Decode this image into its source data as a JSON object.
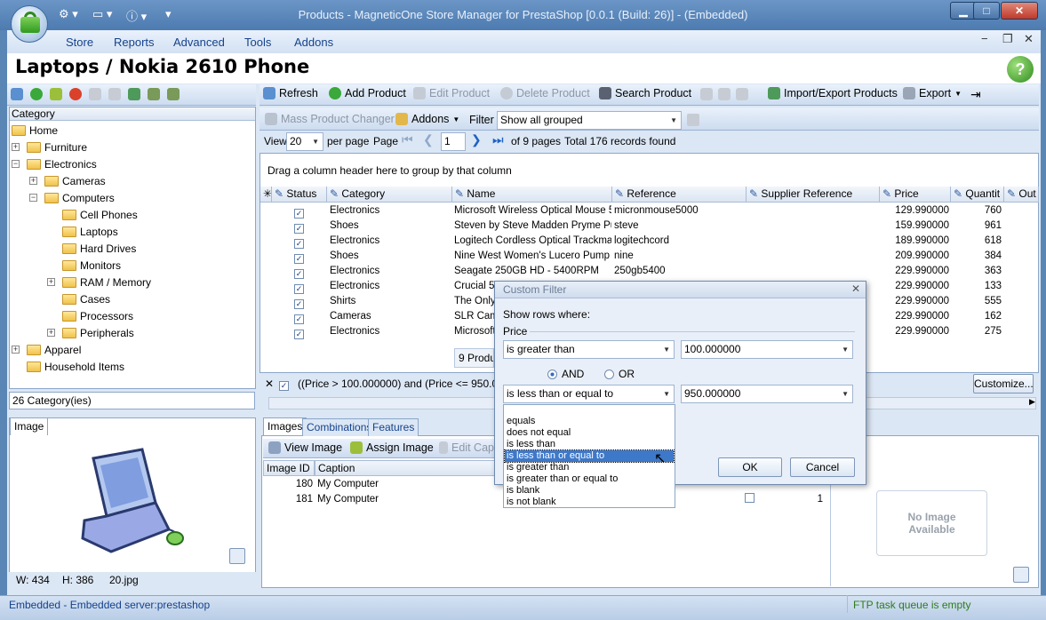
{
  "window": {
    "title": "Products - MagneticOne Store Manager for PrestaShop [0.0.1 (Build: 26)] - (Embedded)"
  },
  "menu": [
    "Store",
    "Reports",
    "Advanced",
    "Tools",
    "Addons"
  ],
  "page_title": "Laptops / Nokia 2610 Phone",
  "help_label": "?",
  "category_panel": {
    "header": "Category",
    "items": [
      {
        "label": "Home",
        "level": 0,
        "expander": ""
      },
      {
        "label": "Furniture",
        "level": 1,
        "expander": "+"
      },
      {
        "label": "Electronics",
        "level": 1,
        "expander": "−"
      },
      {
        "label": "Cameras",
        "level": 2,
        "expander": "+"
      },
      {
        "label": "Computers",
        "level": 2,
        "expander": "−"
      },
      {
        "label": "Cell Phones",
        "level": 3,
        "expander": ""
      },
      {
        "label": "Laptops",
        "level": 3,
        "expander": ""
      },
      {
        "label": "Hard Drives",
        "level": 3,
        "expander": ""
      },
      {
        "label": "Monitors",
        "level": 3,
        "expander": ""
      },
      {
        "label": "RAM / Memory",
        "level": 3,
        "expander": "+"
      },
      {
        "label": "Cases",
        "level": 3,
        "expander": ""
      },
      {
        "label": "Processors",
        "level": 3,
        "expander": ""
      },
      {
        "label": "Peripherals",
        "level": 3,
        "expander": "+"
      },
      {
        "label": "Apparel",
        "level": 1,
        "expander": "+"
      },
      {
        "label": "Household Items",
        "level": 1,
        "expander": ""
      }
    ],
    "count": "26 Category(ies)"
  },
  "image_panel": {
    "tab": "Image",
    "width": "W: 434",
    "height": "H: 386",
    "file": "20.jpg"
  },
  "toolbar": {
    "refresh": "Refresh",
    "add": "Add Product",
    "edit": "Edit Product",
    "delete": "Delete Product",
    "search": "Search Product",
    "import_export": "Import/Export Products",
    "export": "Export"
  },
  "toolbar2": {
    "mass": "Mass Product Changer",
    "addons": "Addons",
    "filter_label": "Filter",
    "filter_value": "Show all grouped"
  },
  "pager": {
    "view": "View",
    "per_page_value": "20",
    "per_page": "per page",
    "page": "Page",
    "page_value": "1",
    "of_pages": "of 9 pages",
    "total": "Total 176 records found"
  },
  "group_hint": "Drag a column header here to group by that column",
  "grid": {
    "columns": [
      "Status",
      "Category",
      "Name",
      "Reference",
      "Supplier Reference",
      "Price",
      "Quantit",
      "Out"
    ],
    "rows": [
      {
        "category": "Electronics",
        "name": "Microsoft Wireless Optical Mouse 500",
        "reference": "micronmouse5000",
        "price": "129.990000",
        "qty": "760"
      },
      {
        "category": "Shoes",
        "name": "Steven by Steve Madden Pryme Pump",
        "reference": "steve",
        "price": "159.990000",
        "qty": "961"
      },
      {
        "category": "Electronics",
        "name": "Logitech Cordless Optical Trackman",
        "reference": "logitechcord",
        "price": "189.990000",
        "qty": "618"
      },
      {
        "category": "Shoes",
        "name": "Nine West Women's Lucero Pump",
        "reference": "nine",
        "price": "209.990000",
        "qty": "384"
      },
      {
        "category": "Electronics",
        "name": "Seagate 250GB HD - 5400RPM",
        "reference": "250gb5400",
        "price": "229.990000",
        "qty": "363"
      },
      {
        "category": "Electronics",
        "name": "Crucial 51",
        "reference": "",
        "price": "229.990000",
        "qty": "133"
      },
      {
        "category": "Shirts",
        "name": "The Only",
        "reference": "",
        "price": "229.990000",
        "qty": "555"
      },
      {
        "category": "Cameras",
        "name": "SLR Came",
        "reference": "",
        "price": "229.990000",
        "qty": "162"
      },
      {
        "category": "Electronics",
        "name": "Microsoft",
        "reference": "",
        "price": "229.990000",
        "qty": "275"
      }
    ],
    "footer": "9 Produc"
  },
  "filter_bar": {
    "text": "((Price > 100.000000) and (Price <= 950.0000",
    "customize": "Customize..."
  },
  "bottom_tabs": {
    "images": "Images",
    "combinations": "Combinations",
    "features": "Features"
  },
  "image_toolbar": {
    "view": "View Image",
    "assign": "Assign Image",
    "edit": "Edit Cap"
  },
  "image_grid": {
    "columns": [
      "Image ID",
      "Caption"
    ],
    "rows": [
      {
        "id": "180",
        "caption": "My Computer",
        "num": "0"
      },
      {
        "id": "181",
        "caption": "My Computer",
        "num": "1"
      }
    ]
  },
  "no_image": "No Image Available",
  "dialog": {
    "title": "Custom Filter",
    "show_rows": "Show rows where:",
    "field": "Price",
    "cond1": "is greater than",
    "val1": "100.000000",
    "and": "AND",
    "or": "OR",
    "cond2": "is less than or equal to",
    "val2": "950.000000",
    "options": [
      "equals",
      "does not equal",
      "is less than",
      "is less than or equal to",
      "is greater than",
      "is greater than or equal to",
      "is blank",
      "is not blank"
    ],
    "ok": "OK",
    "cancel": "Cancel"
  },
  "status": {
    "left": "Embedded - Embedded server:prestashop",
    "right": "FTP task queue is empty"
  }
}
